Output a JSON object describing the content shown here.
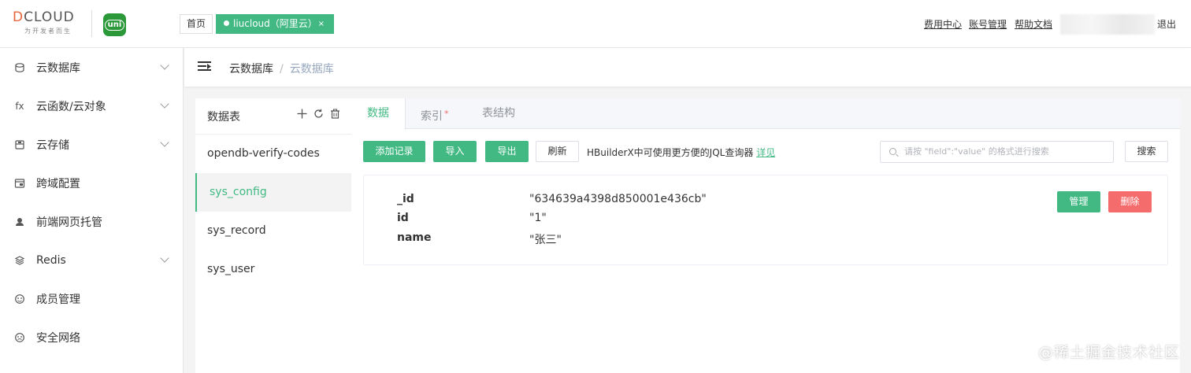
{
  "brand": {
    "logo_text": "DCLOUD",
    "logo_tagline": "为开发者而生",
    "app_badge": "uni"
  },
  "tabs": {
    "home": "首页",
    "active": "liucloud（阿里云）",
    "close": "×"
  },
  "top_links": {
    "billing": "费用中心",
    "account": "账号管理",
    "help": "帮助文档",
    "logout": "退出"
  },
  "sidebar": {
    "items": [
      {
        "label": "云数据库",
        "icon": "database-icon",
        "expandable": true
      },
      {
        "label": "云函数/云对象",
        "icon": "function-icon",
        "icon_text": "fx",
        "expandable": true
      },
      {
        "label": "云存储",
        "icon": "storage-icon",
        "expandable": true
      },
      {
        "label": "跨域配置",
        "icon": "cors-icon",
        "expandable": false
      },
      {
        "label": "前端网页托管",
        "icon": "hosting-icon",
        "expandable": false
      },
      {
        "label": "Redis",
        "icon": "redis-icon",
        "expandable": true
      },
      {
        "label": "成员管理",
        "icon": "members-icon",
        "expandable": false
      },
      {
        "label": "安全网络",
        "icon": "security-icon",
        "expandable": false
      }
    ]
  },
  "breadcrumb": {
    "root": "云数据库",
    "separator": "/",
    "current": "云数据库"
  },
  "tables_panel": {
    "title": "数据表",
    "items": [
      "opendb-verify-codes",
      "sys_config",
      "sys_record",
      "sys_user"
    ],
    "selected": "sys_config"
  },
  "main_tabs": [
    {
      "label": "数据",
      "active": true
    },
    {
      "label": "索引",
      "required_mark": "*"
    },
    {
      "label": "表结构"
    }
  ],
  "toolbar": {
    "add": "添加记录",
    "import": "导入",
    "export": "导出",
    "refresh": "刷新",
    "hint": "HBuilderX中可使用更方便的JQL查询器",
    "hint_link": "详见",
    "search_placeholder": "请按 \"field\":\"value\" 的格式进行搜索",
    "search_button": "搜索"
  },
  "record": {
    "fields": [
      {
        "key": "_id",
        "value": "\"634639a4398d850001e436cb\""
      },
      {
        "key": "id",
        "value": "\"1\""
      },
      {
        "key": "name",
        "value": "\"张三\""
      }
    ],
    "manage": "管理",
    "delete": "删除"
  },
  "watermark": "@稀土掘金技术社区",
  "colors": {
    "accent": "#42b983",
    "danger": "#f56c6c",
    "breadcrumb_current": "#97a8be"
  }
}
